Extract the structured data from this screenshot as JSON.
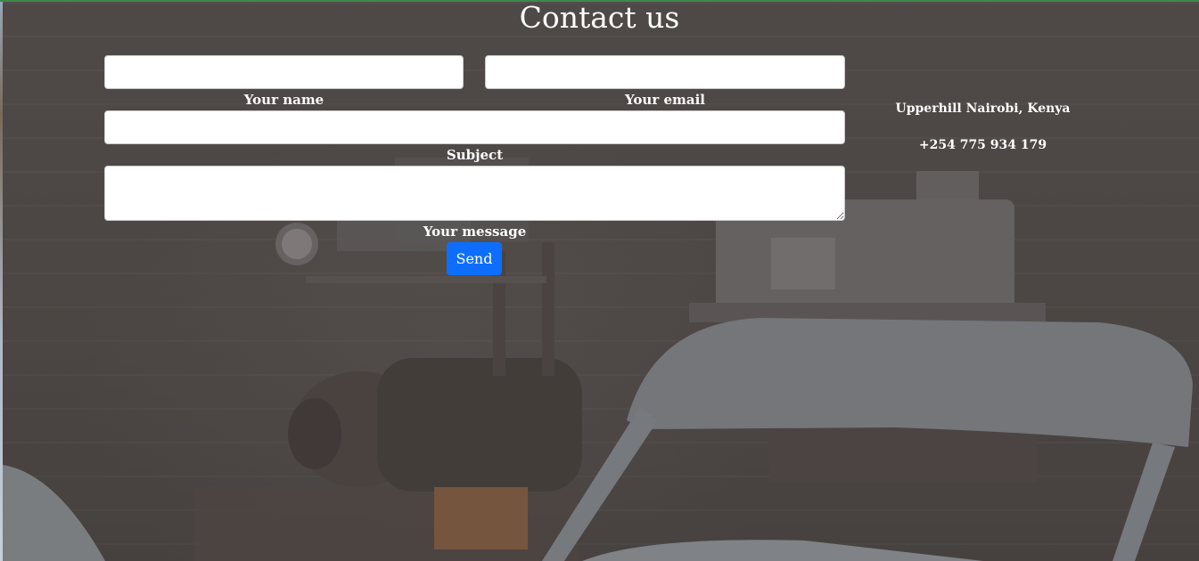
{
  "header": {
    "title": "Contact us"
  },
  "form": {
    "name": {
      "label": "Your name",
      "value": ""
    },
    "email": {
      "label": "Your email",
      "value": ""
    },
    "subject": {
      "label": "Subject",
      "value": ""
    },
    "message": {
      "label": "Your message",
      "value": ""
    },
    "send_label": "Send"
  },
  "contact": {
    "address": "Upperhill Nairobi, Kenya",
    "phone": "+254 775 934 179"
  },
  "colors": {
    "accent": "#0d6efd",
    "top_border": "#3e8a4a"
  }
}
